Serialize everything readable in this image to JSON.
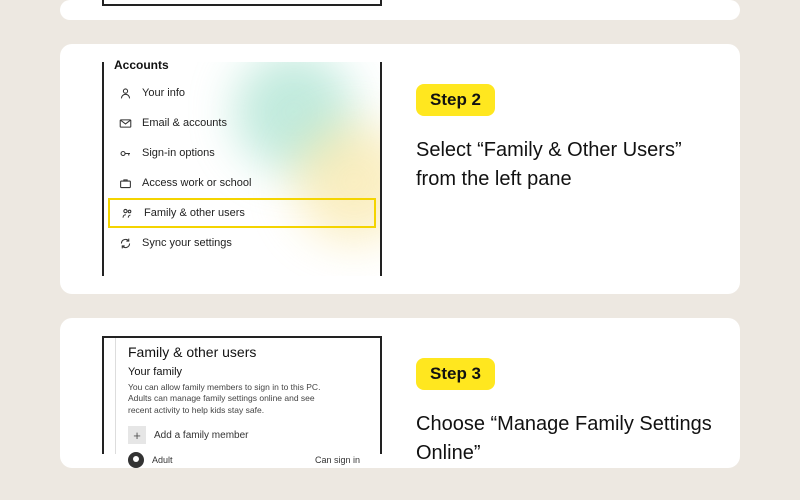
{
  "colors": {
    "accent": "#ffe71f"
  },
  "step1_frame_visible": true,
  "step2": {
    "badge": "Step 2",
    "text": "Select “Family & Other Users” from the left pane",
    "sidebar_title": "Accounts",
    "menu": {
      "your_info": "Your info",
      "email": "Email & accounts",
      "signin": "Sign-in options",
      "access": "Access work or school",
      "family": "Family & other users",
      "sync": "Sync your settings"
    }
  },
  "step3": {
    "badge": "Step 3",
    "text": "Choose “Manage Family Settings Online”",
    "heading": "Family & other users",
    "section": "Your family",
    "description": "You can allow family members to sign in to this PC. Adults can manage family settings online and see recent activity to help kids stay safe.",
    "add_label": "Add a family member",
    "row_name": "Adult",
    "row_right": "Can sign in"
  }
}
